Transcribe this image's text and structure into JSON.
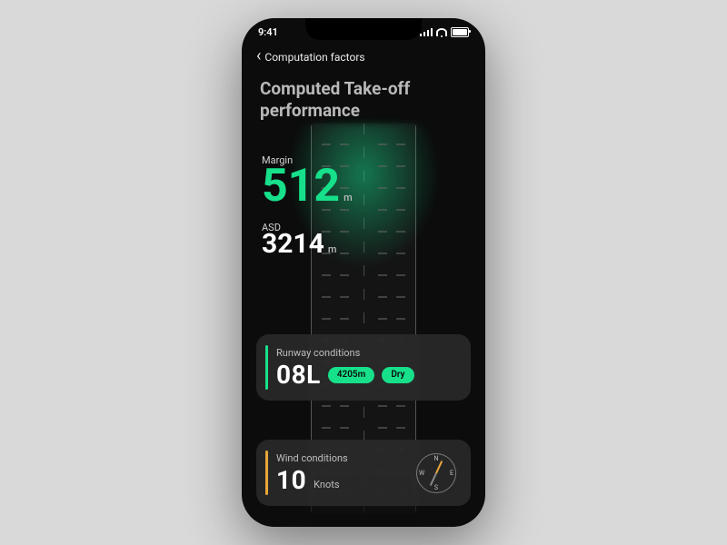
{
  "status": {
    "time": "9:41"
  },
  "nav": {
    "back_label": "Computation factors"
  },
  "title": "Computed Take-off performance",
  "metrics": {
    "margin": {
      "label": "Margin",
      "value": "512",
      "unit": "m"
    },
    "asd": {
      "label": "ASD",
      "value": "3214",
      "unit": "m"
    }
  },
  "cards": {
    "runway": {
      "label": "Runway conditions",
      "id": "08L",
      "length": "4205m",
      "state": "Dry"
    },
    "wind": {
      "label": "Wind conditions",
      "value": "10",
      "unit": "Knots",
      "compass": {
        "n": "N",
        "s": "S",
        "e": "E",
        "w": "W"
      }
    }
  }
}
